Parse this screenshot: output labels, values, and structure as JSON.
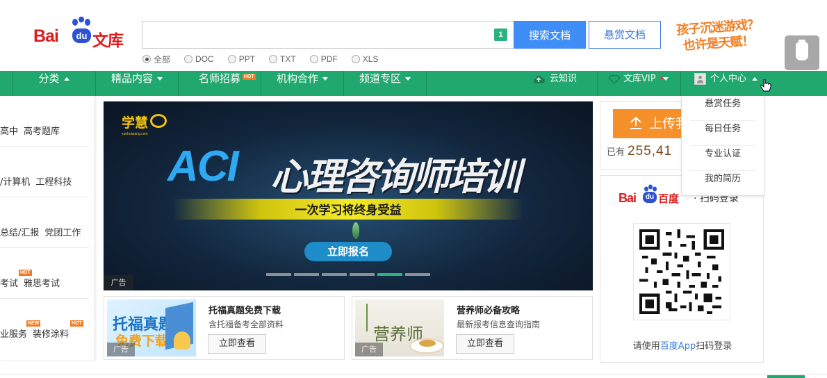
{
  "header": {
    "logo": {
      "bai": "Bai",
      "du": "du",
      "wenku": "文库"
    },
    "search": {
      "value": "",
      "placeholder": "",
      "badge": "1",
      "button_label": "搜索文档",
      "reward_label": "悬赏文档"
    },
    "filters": [
      {
        "label": "全部",
        "checked": true
      },
      {
        "label": "DOC",
        "checked": false
      },
      {
        "label": "PPT",
        "checked": false
      },
      {
        "label": "TXT",
        "checked": false
      },
      {
        "label": "PDF",
        "checked": false
      },
      {
        "label": "XLS",
        "checked": false
      }
    ],
    "slogan": {
      "line1": "孩子沉迷游戏？",
      "line2": "也许是天赋！"
    }
  },
  "nav": {
    "items": [
      {
        "label": "分类",
        "arrow": "up"
      },
      {
        "label": "精品内容",
        "arrow": "down"
      },
      {
        "label": "名师招募",
        "badge": "HOT"
      },
      {
        "label": "机构合作",
        "arrow": "down"
      },
      {
        "label": "频道专区",
        "arrow": "down"
      }
    ],
    "right": {
      "cloud": "云知识",
      "vip": "文库VIP",
      "user_center": "个人中心"
    }
  },
  "dropdown": {
    "items": [
      "悬赏任务",
      "每日任务",
      "专业认证",
      "我的简历"
    ]
  },
  "categories": [
    {
      "links": [
        "高中",
        "高考题库"
      ]
    },
    {
      "links": [
        "/计算机",
        "工程科技"
      ]
    },
    {
      "links": [
        "总结/汇报",
        "党团工作"
      ]
    },
    {
      "links": [
        "考试",
        "雅思考试"
      ],
      "badge": "HOT"
    },
    {
      "links": [
        "业服务",
        "装修涂料"
      ],
      "badges": [
        "NEW",
        "HOT"
      ]
    }
  ],
  "banner": {
    "brand": "学慧",
    "brand_sub": "xuehuiwang.com",
    "headline_en": "ACI",
    "headline_cn": "心理咨询师培训",
    "tagline": "一次学习将终身受益",
    "cta": "立即报名",
    "ad_tag": "广告",
    "slides": 6,
    "active_slide": 5
  },
  "cards": [
    {
      "title": "托福真题免费下载",
      "desc": "含托福备考全部资料",
      "button": "立即查看",
      "thumb_line1": "托福真题",
      "thumb_line2": "免费下载",
      "ad_tag": "广告"
    },
    {
      "title": "营养师必备攻略",
      "desc": "最新报考信息查询指南",
      "button": "立即查看",
      "thumb_text": "营养师",
      "ad_tag": "广告"
    }
  ],
  "upload": {
    "button": "上传我",
    "stat_prefix": "已有",
    "stat_number": "255,41"
  },
  "login": {
    "logo_bai": "Bai",
    "logo_du": "du",
    "logo_baidu": "百度",
    "title": "· 扫码登录",
    "hint_prefix": "请使用",
    "hint_app": "百度App",
    "hint_suffix": "扫码登录"
  },
  "colors": {
    "nav_green": "#21a86f",
    "search_blue": "#3f8ef7",
    "brand_red": "#de1a1b",
    "upload_orange": "#f5902b"
  }
}
